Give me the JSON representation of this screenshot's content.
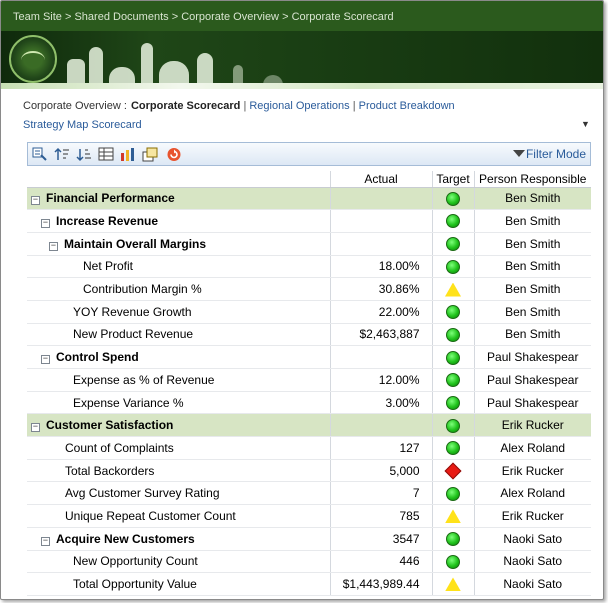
{
  "breadcrumb": [
    "Team Site",
    "Shared Documents",
    "Corporate Overview",
    "Corporate Scorecard"
  ],
  "breadcrumb_sep": " > ",
  "nav": {
    "prefix": "Corporate Overview :",
    "current": "Corporate Scorecard",
    "links": [
      "Regional Operations",
      "Product Breakdown",
      "Strategy Map Scorecard"
    ],
    "menu_arrow": "▼"
  },
  "toolbar": {
    "icons": [
      "drill-icon",
      "sort-ascending-icon",
      "sort-descending-icon",
      "table-icon",
      "chart-icon",
      "show-details-icon",
      "refresh-icon"
    ],
    "filter_label": "Filter Mode"
  },
  "grid": {
    "columns": [
      "",
      "Actual",
      "Target",
      "Person Responsible"
    ],
    "rows": [
      {
        "level": 0,
        "expander": true,
        "bold": true,
        "section": true,
        "name": "Financial Performance",
        "actual": "",
        "status": "green",
        "person": "Ben Smith"
      },
      {
        "level": 1,
        "expander": true,
        "bold": true,
        "section": false,
        "name": "Increase Revenue",
        "actual": "",
        "status": "green",
        "person": "Ben Smith"
      },
      {
        "level": 2,
        "expander": true,
        "bold": true,
        "section": false,
        "name": "Maintain Overall Margins",
        "actual": "",
        "status": "green",
        "person": "Ben Smith"
      },
      {
        "level": 3,
        "expander": false,
        "bold": false,
        "section": false,
        "name": "Net Profit",
        "actual": "18.00%",
        "status": "green",
        "person": "Ben Smith"
      },
      {
        "level": 3,
        "expander": false,
        "bold": false,
        "section": false,
        "name": "Contribution Margin %",
        "actual": "30.86%",
        "status": "yellow",
        "person": "Ben Smith"
      },
      {
        "level": 2,
        "expander": false,
        "bold": false,
        "section": false,
        "name": "YOY Revenue Growth",
        "actual": "22.00%",
        "status": "green",
        "person": "Ben Smith"
      },
      {
        "level": 2,
        "expander": false,
        "bold": false,
        "section": false,
        "name": "New Product Revenue",
        "actual": "$2,463,887",
        "status": "green",
        "person": "Ben Smith"
      },
      {
        "level": 1,
        "expander": true,
        "bold": true,
        "section": false,
        "name": "Control Spend",
        "actual": "",
        "status": "green",
        "person": "Paul Shakespear"
      },
      {
        "level": 2,
        "expander": false,
        "bold": false,
        "section": false,
        "name": "Expense as % of Revenue",
        "actual": "12.00%",
        "status": "green",
        "person": "Paul Shakespear"
      },
      {
        "level": 2,
        "expander": false,
        "bold": false,
        "section": false,
        "name": "Expense Variance %",
        "actual": "3.00%",
        "status": "green",
        "person": "Paul Shakespear"
      },
      {
        "level": 0,
        "expander": true,
        "bold": true,
        "section": true,
        "name": "Customer Satisfaction",
        "actual": "",
        "status": "green",
        "person": "Erik Rucker"
      },
      {
        "level": 1,
        "expander": false,
        "bold": false,
        "section": false,
        "name": "Count of Complaints",
        "actual": "127",
        "status": "green",
        "person": "Alex Roland"
      },
      {
        "level": 1,
        "expander": false,
        "bold": false,
        "section": false,
        "name": "Total Backorders",
        "actual": "5,000",
        "status": "red",
        "person": "Erik Rucker"
      },
      {
        "level": 1,
        "expander": false,
        "bold": false,
        "section": false,
        "name": "Avg Customer Survey Rating",
        "actual": "7",
        "status": "green",
        "person": "Alex Roland"
      },
      {
        "level": 1,
        "expander": false,
        "bold": false,
        "section": false,
        "name": "Unique Repeat Customer Count",
        "actual": "785",
        "status": "yellow",
        "person": "Erik Rucker"
      },
      {
        "level": 1,
        "expander": true,
        "bold": true,
        "section": false,
        "name": "Acquire New Customers",
        "actual": "3547",
        "status": "green",
        "person": "Naoki Sato"
      },
      {
        "level": 2,
        "expander": false,
        "bold": false,
        "section": false,
        "name": "New Opportunity Count",
        "actual": "446",
        "status": "green",
        "person": "Naoki Sato"
      },
      {
        "level": 2,
        "expander": false,
        "bold": false,
        "section": false,
        "name": "Total Opportunity Value",
        "actual": "$1,443,989.44",
        "status": "yellow",
        "person": "Naoki Sato"
      }
    ]
  },
  "colors": {
    "section_row": "#d7e5c4",
    "link": "#2a5b9a",
    "banner": "#1f4617",
    "status_green": "#1fc21b",
    "status_yellow": "#ffe21a",
    "status_red": "#e81b14"
  }
}
